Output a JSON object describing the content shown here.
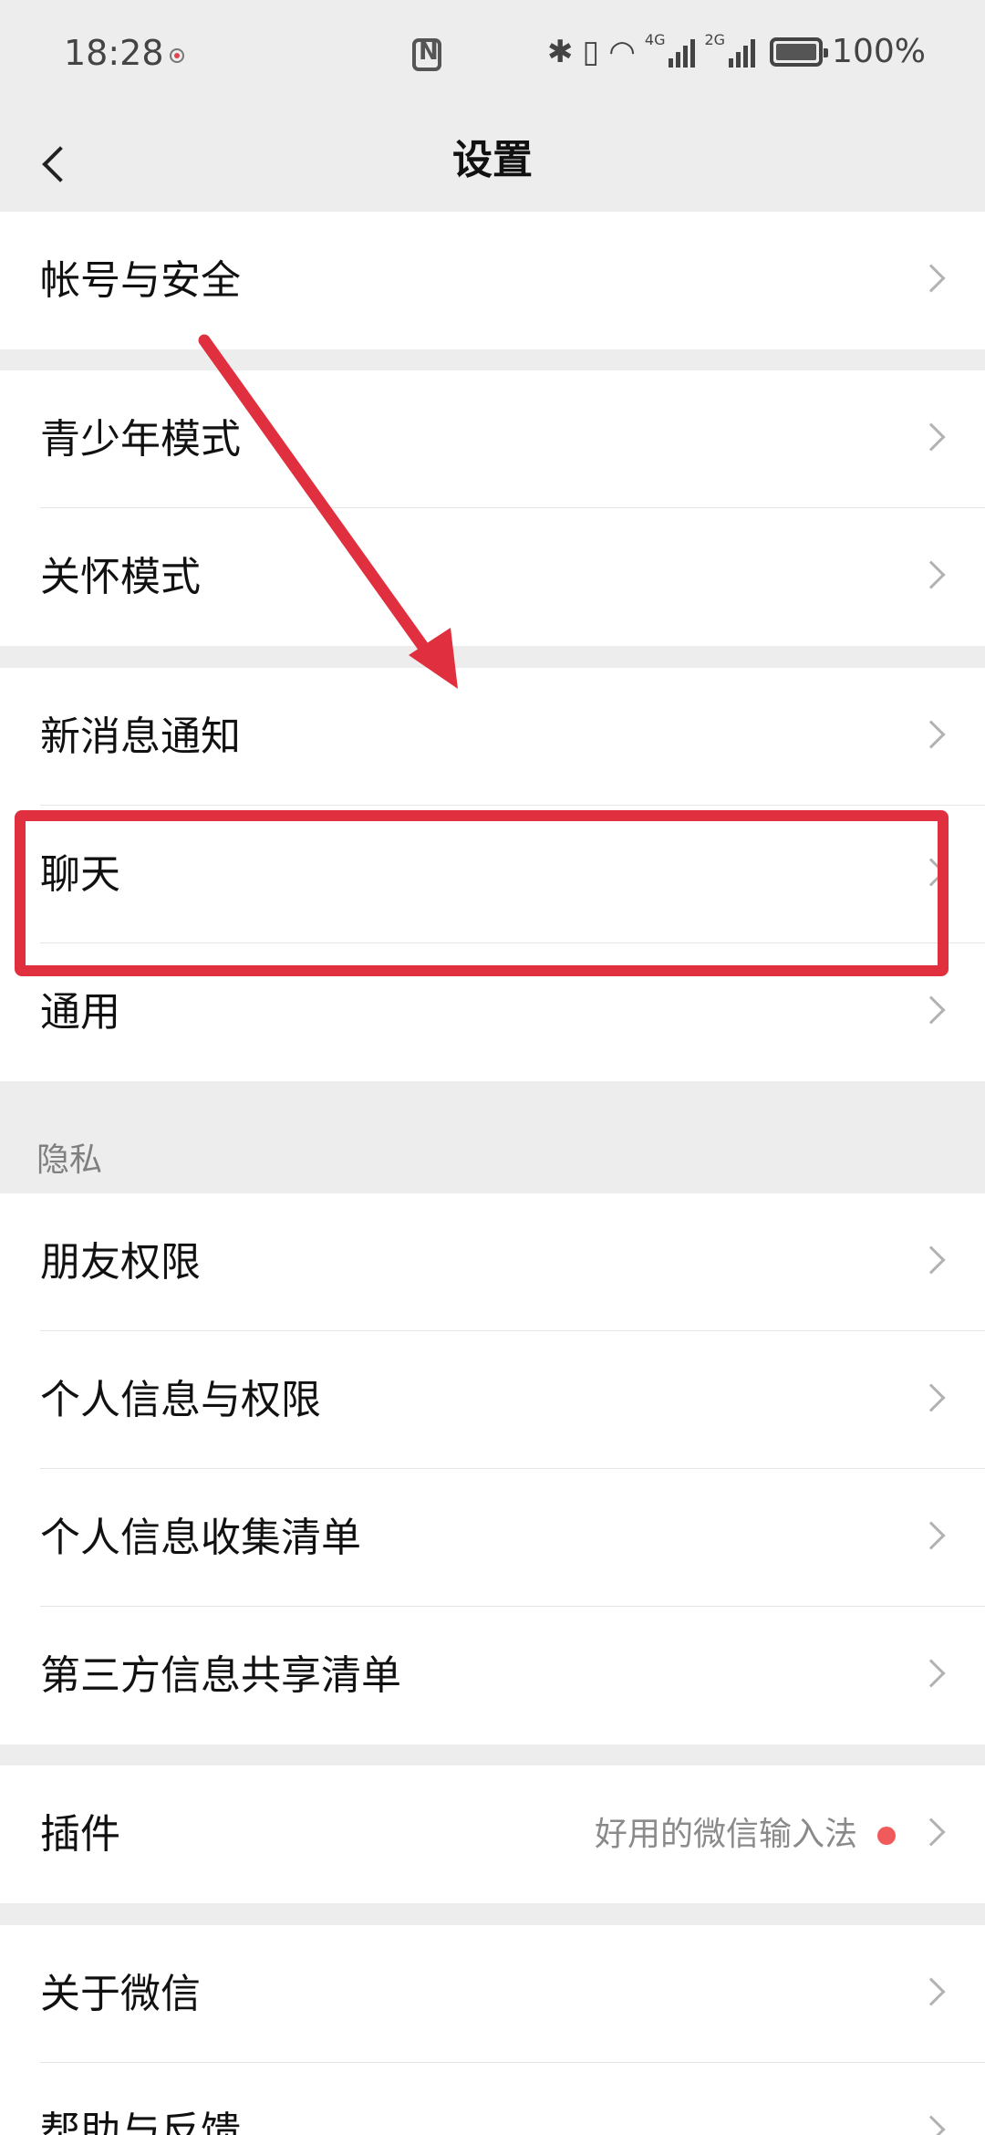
{
  "status_bar": {
    "time": "18:28",
    "net1": "4G",
    "net2": "2G",
    "battery": "100%",
    "icons": [
      "notification-dot-icon",
      "nfc-icon",
      "bluetooth-icon",
      "vibrate-icon",
      "wifi-icon",
      "signal-icon",
      "signal-icon",
      "battery-icon"
    ]
  },
  "header": {
    "title": "设置",
    "back_icon": "chevron-left-icon"
  },
  "groups": {
    "account": {
      "security": "帐号与安全"
    },
    "modes": {
      "youth": "青少年模式",
      "care": "关怀模式"
    },
    "general": {
      "notifications": "新消息通知",
      "chat": "聊天",
      "general": "通用"
    },
    "privacy": {
      "section_title": "隐私",
      "friend_permissions": "朋友权限",
      "personal_info_permissions": "个人信息与权限",
      "personal_info_list": "个人信息收集清单",
      "third_party_list": "第三方信息共享清单"
    },
    "plugins": {
      "label": "插件",
      "value": "好用的微信输入法"
    },
    "about": {
      "about_wechat": "关于微信",
      "help_feedback": "帮助与反馈"
    }
  },
  "colors": {
    "annotation": "#e03040",
    "badge": "#f05a5a",
    "background": "#ededed"
  }
}
